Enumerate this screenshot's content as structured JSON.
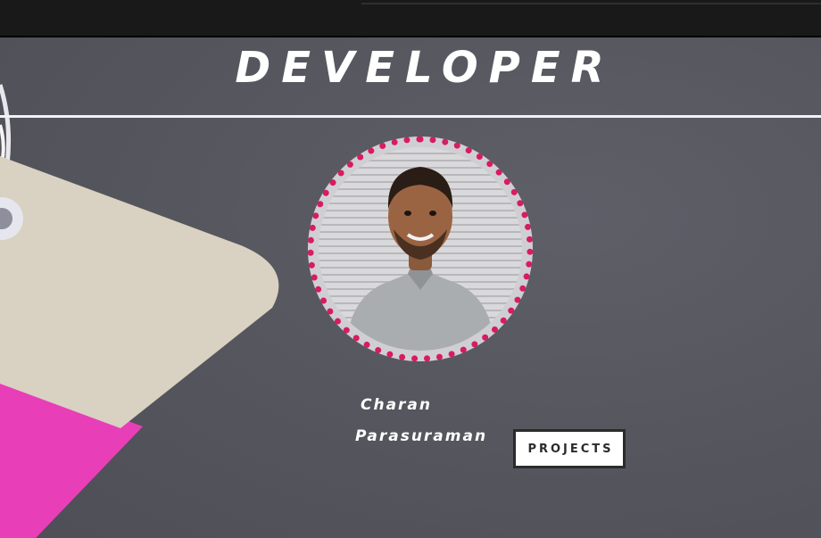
{
  "header": {
    "title": "DEVELOPER"
  },
  "profile": {
    "first_name": "Charan",
    "last_name": "Parasuraman",
    "photo_alt": "Profile photo"
  },
  "actions": {
    "projects_label": "PROJECTS"
  },
  "colors": {
    "background": "#55555d",
    "top_bar": "#191919",
    "accent_ring": "#d81b62",
    "tag_paper": "#d9d1c1",
    "tag_pink": "#e83fb8",
    "text": "#ffffff"
  },
  "icons": {
    "avatar": "person-portrait"
  }
}
